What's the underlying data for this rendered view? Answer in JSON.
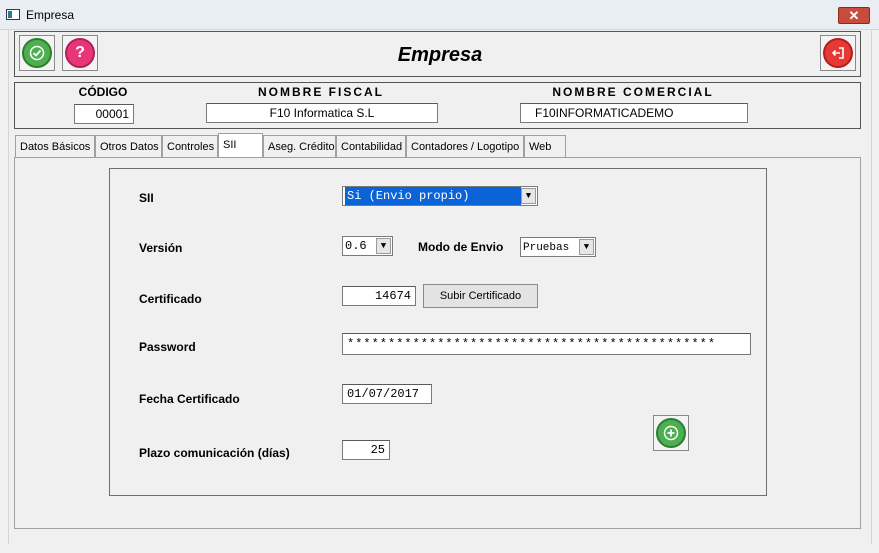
{
  "window": {
    "title": "Empresa",
    "close_label": "✕"
  },
  "header": {
    "title": "Empresa"
  },
  "toolbar": {
    "accept_icon": "check-circle-icon",
    "help_icon": "help-circle-icon",
    "exit_icon": "exit-icon",
    "colors": {
      "accept": "#4caf50",
      "help": "#e8357a",
      "exit": "#e53935"
    }
  },
  "company": {
    "code_label": "CÓDIGO",
    "code_value": "00001",
    "fiscal_label": "NOMBRE FISCAL",
    "fiscal_value": "F10 Informatica S.L",
    "commercial_label": "NOMBRE COMERCIAL",
    "commercial_value": "F10INFORMATICADEMO"
  },
  "tabs": [
    {
      "label": "Datos Básicos"
    },
    {
      "label": "Otros Datos"
    },
    {
      "label": "Controles"
    },
    {
      "label": "SII",
      "active": true
    },
    {
      "label": "Aseg. Crédito"
    },
    {
      "label": "Contabilidad"
    },
    {
      "label": "Contadores / Logotipo"
    },
    {
      "label": "Web"
    }
  ],
  "sii": {
    "sii_label": "SII",
    "sii_value": "Si (Envio propio)",
    "version_label": "Versión",
    "version_value": "0.6",
    "send_mode_label": "Modo de Envio",
    "send_mode_value": "Pruebas",
    "cert_label": "Certificado",
    "cert_value": "14674",
    "upload_cert_label": "Subir Certificado",
    "password_label": "Password",
    "password_value": "*********************************************",
    "cert_date_label": "Fecha Certificado",
    "cert_date_value": "01/07/2017",
    "term_label": "Plazo comunicación  (días)",
    "term_value": "25"
  }
}
